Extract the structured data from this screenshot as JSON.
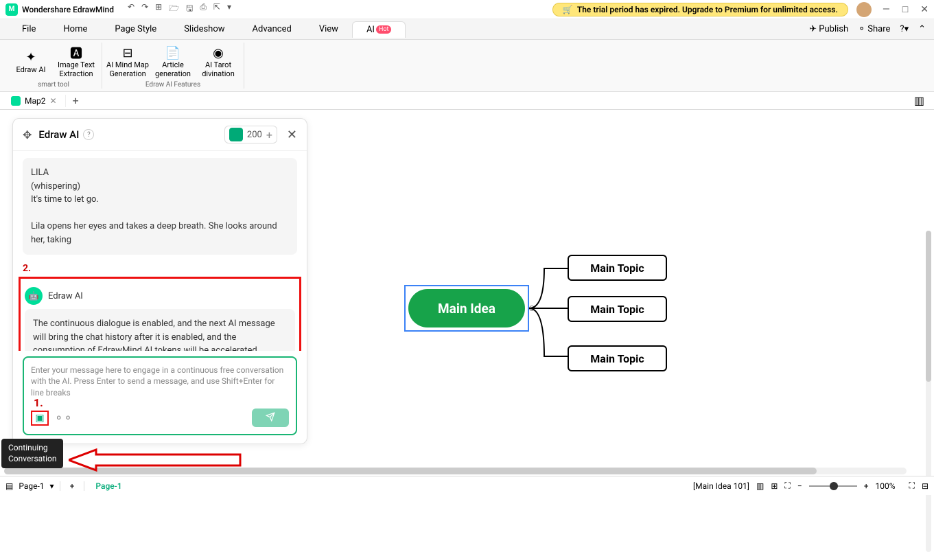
{
  "titlebar": {
    "app_name": "Wondershare EdrawMind",
    "trial_text": "The trial period has expired. Upgrade to Premium for unlimited access."
  },
  "menubar": {
    "items": [
      "File",
      "Home",
      "Page Style",
      "Slideshow",
      "Advanced",
      "View",
      "AI"
    ],
    "hot_label": "Hot",
    "publish": "Publish",
    "share": "Share"
  },
  "ribbon": {
    "tools": [
      {
        "label": "Edraw AI"
      },
      {
        "label": "Image Text Extraction"
      },
      {
        "label": "AI Mind Map Generation"
      },
      {
        "label": "Article generation"
      },
      {
        "label": "AI Tarot divination"
      }
    ],
    "group1": "smart tool",
    "group2": "Edraw AI Features"
  },
  "doctabs": {
    "tab1": "Map2"
  },
  "ai_panel": {
    "title": "Edraw AI",
    "tokens": "200",
    "msg_lila": "LILA",
    "msg_whisper": "(whispering)",
    "msg_letgo": "It's time to let go.",
    "msg_scene": "Lila opens her eyes and takes a deep breath. She looks around her, taking",
    "label2": "2.",
    "ai_name": "Edraw AI",
    "system_msg": "The continuous dialogue is enabled, and the next AI message will bring the chat history after it is enabled, and the consumption of EdrawMind AI tokens will be accelerated.",
    "placeholder": "Enter your message here to engage in a continuous free conversation with the AI. Press Enter to send a message, and use Shift+Enter for line breaks",
    "label1": "1."
  },
  "tooltip": {
    "line1": "Continuing",
    "line2": "Conversation"
  },
  "mindmap": {
    "main": "Main Idea",
    "topic": "Main Topic"
  },
  "statusbar": {
    "page_label": "Page-1",
    "page_tab": "Page-1",
    "context": "[Main Idea 101]",
    "zoom": "100%"
  }
}
